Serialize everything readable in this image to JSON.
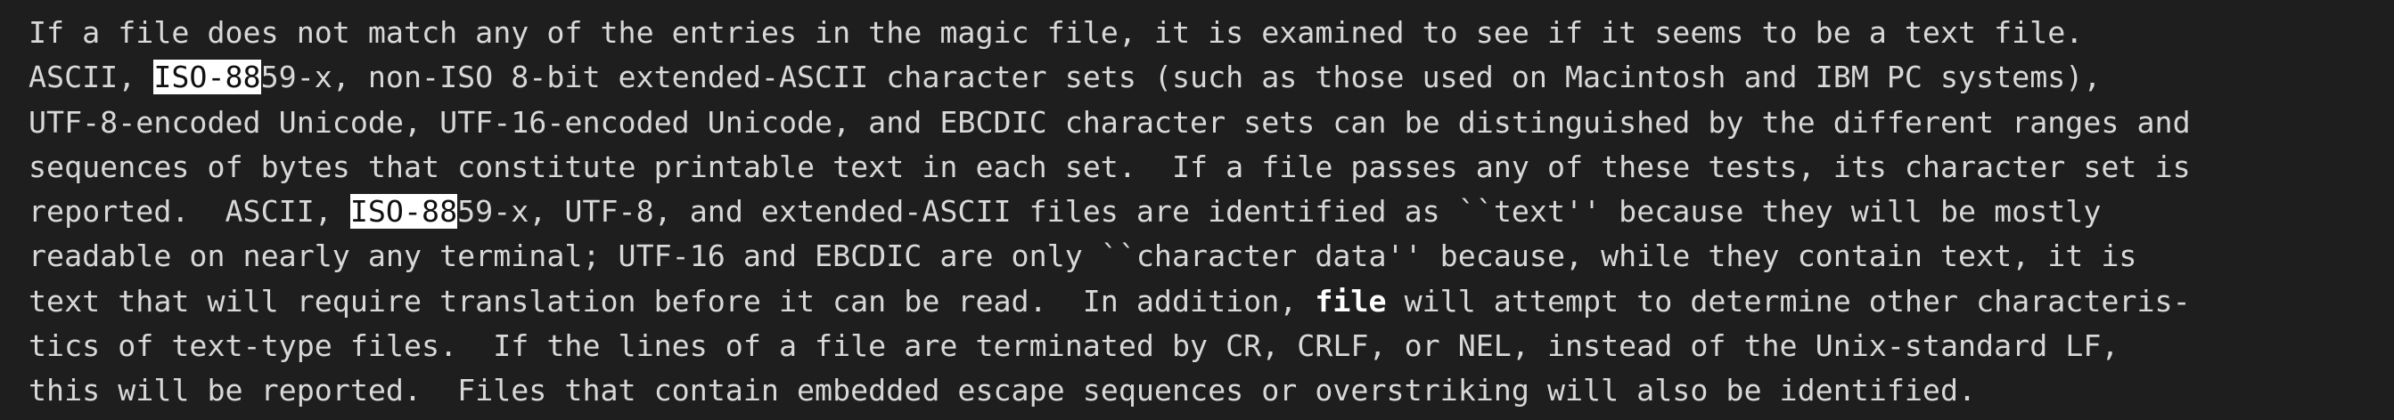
{
  "window": {
    "background": "#1e1e1e",
    "foreground": "#d8d8d8",
    "highlight_bg": "#ffffff",
    "highlight_fg": "#101010"
  },
  "man_page": {
    "line1": "If a file does not match any of the entries in the magic file, it is examined to see if it seems to be a text file.",
    "line2_pre": "ASCII, ",
    "line2_match": "ISO-88",
    "line2_post": "59-x, non-ISO 8-bit extended-ASCII character sets (such as those used on Macintosh and IBM PC systems),",
    "line3": "UTF-8-encoded Unicode, UTF-16-encoded Unicode, and EBCDIC character sets can be distinguished by the different ranges and",
    "line4": "sequences of bytes that constitute printable text in each set.  If a file passes any of these tests, its character set is",
    "line5_pre": "reported.  ASCII, ",
    "line5_match": "ISO-88",
    "line5_post": "59-x, UTF-8, and extended-ASCII files are identified as ``text'' because they will be mostly",
    "line6": "readable on nearly any terminal; UTF-16 and EBCDIC are only ``character data'' because, while they contain text, it is",
    "line7_pre": "text that will require translation before it can be read.  In addition, ",
    "line7_bold": "file",
    "line7_post": " will attempt to determine other characteris-",
    "line8": "tics of text-type files.  If the lines of a file are terminated by CR, CRLF, or NEL, instead of the Unix-standard LF,",
    "line9": "this will be reported.  Files that contain embedded escape sequences or overstriking will also be identified."
  }
}
